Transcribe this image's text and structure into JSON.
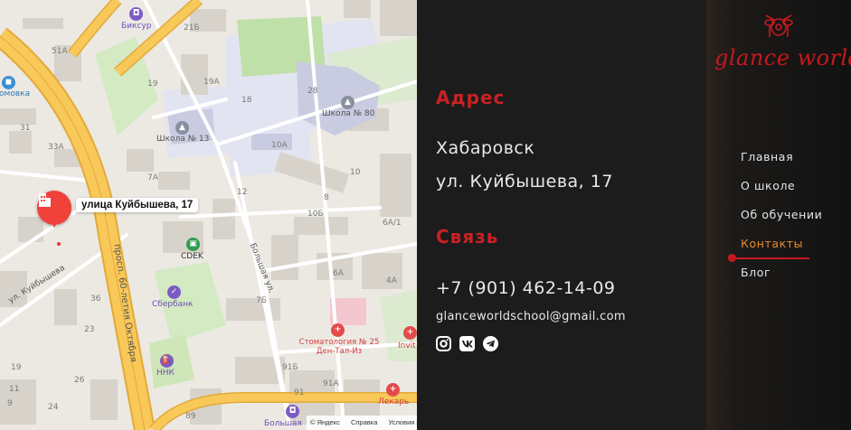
{
  "map": {
    "pin_label": "улица Куйбышева, 17",
    "attribution": [
      "© Яндекс",
      "Справка",
      "Условия и"
    ],
    "streets": [
      "ул. Куйбышева",
      "просп. 60-летия Октября",
      "Большая ул."
    ],
    "house_numbers": [
      "51A",
      "21Б",
      "19",
      "19A",
      "18",
      "28",
      "31",
      "33A",
      "7A",
      "10",
      "12",
      "10A",
      "10Б",
      "8",
      "6A/1",
      "4A",
      "6A",
      "7Б",
      "36",
      "23",
      "91Б",
      "91",
      "91A",
      "26",
      "24",
      "89",
      "11",
      "9",
      "19"
    ],
    "pois": [
      {
        "name": "Биксур",
        "icon": "shopping-bag-icon",
        "color": "#7c5cc4"
      },
      {
        "name": "Школа № 13",
        "icon": "school-icon",
        "color": "#8a8fa0"
      },
      {
        "name": "Школа № 80",
        "icon": "school-icon",
        "color": "#8a8fa0"
      },
      {
        "name": "CDEK",
        "icon": "delivery-icon",
        "color": "#2e9d4d"
      },
      {
        "name": "Сбербанк",
        "icon": "bank-icon",
        "color": "#7c5cc4"
      },
      {
        "name": "ННК",
        "icon": "fuel-icon",
        "color": "#7c5cc4"
      },
      {
        "name": "Стоматология № 25 Ден-Тал-Из",
        "icon": "tooth-icon",
        "color": "#e34b4b"
      },
      {
        "name": "Лекарь",
        "icon": "pharmacy-icon",
        "color": "#e34b4b"
      },
      {
        "name": "Invit",
        "icon": "pharmacy-icon",
        "color": "#e34b4b"
      },
      {
        "name": "Домовка",
        "icon": "store-icon",
        "color": "#3a8fd6"
      },
      {
        "name": "Большая",
        "icon": "store-icon",
        "color": "#7c5cc4"
      }
    ],
    "colors": {
      "road_major": "#f8c959",
      "road_edge": "#e3a93a",
      "building": "#dcd8d0",
      "green": "#cfe6b8"
    }
  },
  "contact": {
    "address_heading": "Адрес",
    "city": "Хабаровск",
    "street": "ул. Куйбышева, 17",
    "connection_heading": "Связь",
    "phone": "+7 (901) 462-14-09",
    "email": "glanceworldschool@gmail.com",
    "social": [
      "instagram-icon",
      "vk-icon",
      "telegram-icon"
    ],
    "heading_color": "#c92124"
  },
  "sidebar": {
    "logo_text": "glance world",
    "nav": [
      {
        "label": "Главная",
        "active": false
      },
      {
        "label": "О школе",
        "active": false
      },
      {
        "label": "Об обучении",
        "active": false
      },
      {
        "label": "Контакты",
        "active": true
      },
      {
        "label": "Блог",
        "active": false
      }
    ],
    "accent_color": "#c8181d",
    "active_color": "#e68a2e"
  }
}
